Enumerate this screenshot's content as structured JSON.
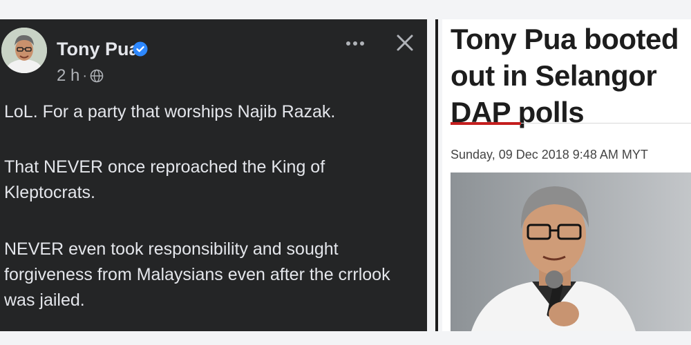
{
  "post": {
    "author": "Tony Pua",
    "time": "2 h",
    "separator": "·",
    "paragraphs": [
      "LoL. For a party that worships Najib Razak.",
      "That NEVER once reproached the King of Kleptocrats.",
      "NEVER even took responsibility and sought forgiveness from Malaysians even after the crrlook was jailed."
    ],
    "icons": {
      "verified": "verified-badge-icon",
      "audience": "globe-icon",
      "more": "more-options-icon",
      "close": "close-icon"
    }
  },
  "article": {
    "headline": "Tony Pua booted out in Selangor DAP polls",
    "dateline": "Sunday, 09 Dec 2018  9:48 AM MYT"
  },
  "colors": {
    "post_bg": "#242526",
    "post_text": "#e4e6eb",
    "muted_text": "#b0b3b8",
    "verified_blue": "#2d88ff",
    "headline_accent": "#c41e1e"
  }
}
